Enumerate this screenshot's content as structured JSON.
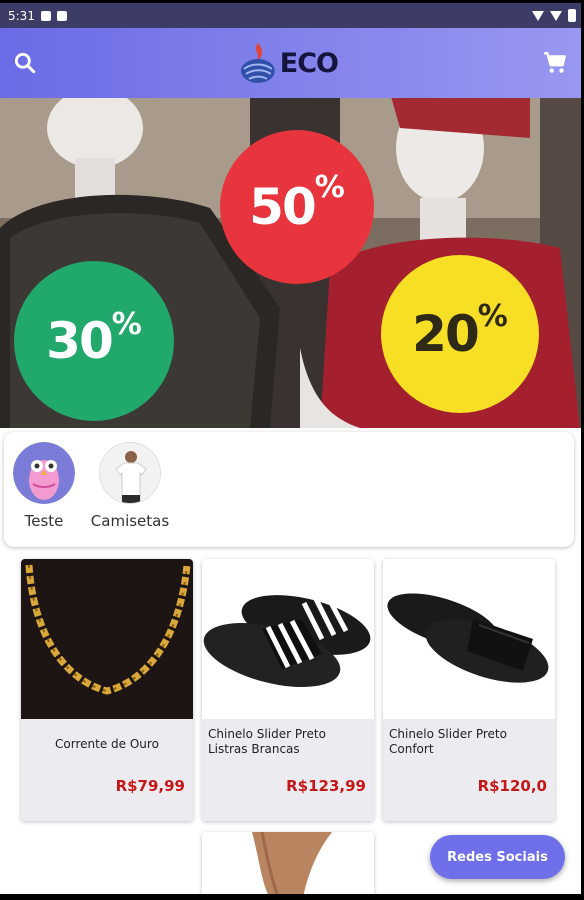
{
  "status_bar": {
    "time": "5:31"
  },
  "app_bar": {
    "logo_text": "ECO",
    "search_icon": "search-icon",
    "cart_icon": "shopping-cart-icon",
    "accent": "#7272e8"
  },
  "banner": {
    "discounts": [
      {
        "num": "50",
        "pct": "%",
        "color": "#e8353d"
      },
      {
        "num": "30",
        "pct": "%",
        "color": "#21a86b"
      },
      {
        "num": "20",
        "pct": "%",
        "color": "#f6df24"
      }
    ]
  },
  "categories": [
    {
      "label": "Teste"
    },
    {
      "label": "Camisetas"
    }
  ],
  "products": [
    {
      "name": "Corrente de Ouro",
      "price": "R$79,99"
    },
    {
      "name": "Chinelo Slider Preto Listras Brancas",
      "price": "R$123,99"
    },
    {
      "name": "Chinelo Slider Preto Confort",
      "price": "R$120,0"
    }
  ],
  "fab": {
    "label": "Redes Sociais"
  }
}
